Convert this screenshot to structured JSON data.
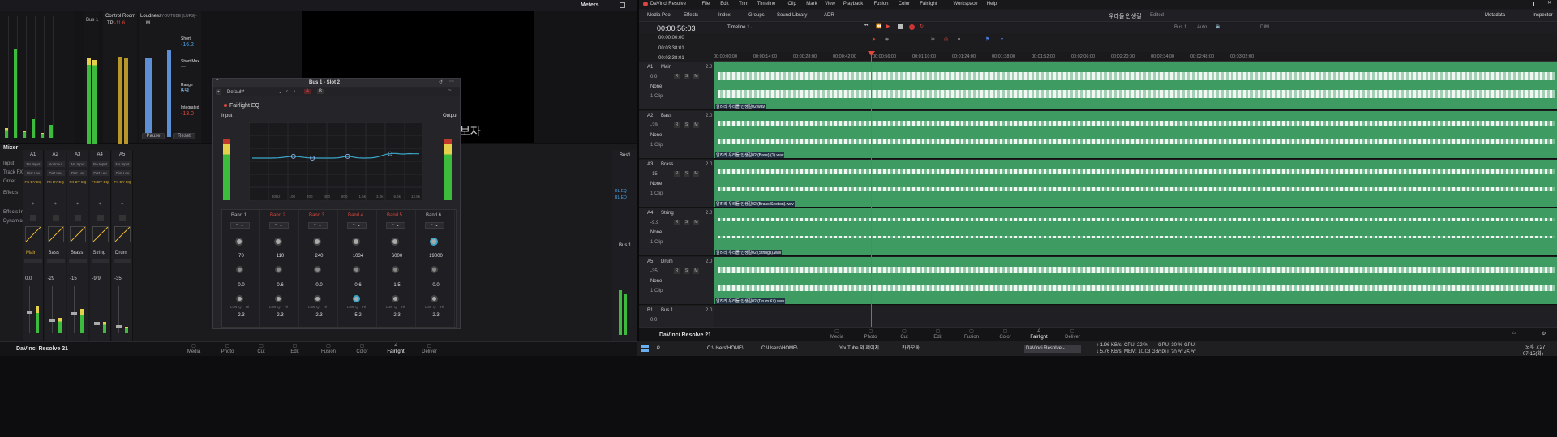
{
  "meters": {
    "title": "Meters",
    "bus_label": "Bus 1",
    "control_room": "Control Room",
    "tp_label": "TP",
    "tp_value": "-11.6",
    "loudness_label": "Loudness",
    "loudness_standard": "YOUTUBE (LUFS)",
    "m_label": "M",
    "short_label": "Short",
    "short_value": "-16.2",
    "short_max_label": "Short Max",
    "short_max_value": "---",
    "range_label": "Range (LU)",
    "range_value": "5.3",
    "integrated_label": "Integrated",
    "integrated_value": "-13.0",
    "pause_label": "Pause",
    "reset_label": "Reset",
    "overlay_text": "보자"
  },
  "mixer": {
    "title": "Mixer",
    "channels": [
      "A1",
      "A2",
      "A3",
      "A4",
      "A5"
    ],
    "row_labels": [
      "Input",
      "Track FX",
      "Order",
      "Effects",
      "Effects In",
      "Dynamics"
    ],
    "input_value": "No Input",
    "track_fx_value": "Dist Lev",
    "order_value": "FX DY EQ",
    "track_names": [
      "Main",
      "Bass",
      "Brass",
      "String",
      "Drum"
    ],
    "fader_values": [
      "0.0",
      "-29",
      "-15",
      "-9.9",
      "-35"
    ],
    "bus_label": "Bus1",
    "bus_name": "Bus 1",
    "bus_eq": [
      "RL EQ",
      "RL EQ"
    ]
  },
  "eq": {
    "title": "Bus 1 - Slot 2",
    "preset": "Default*",
    "ab": [
      "A",
      "B"
    ],
    "plugin_name": "Fairlight EQ",
    "input_label": "Input",
    "output_label": "Output",
    "freq_ticks": [
      "30Hz",
      "100",
      "200",
      "400",
      "800",
      "1.6k",
      "3.2k",
      "6.4k",
      "12.8k"
    ],
    "bands": [
      {
        "name": "Band 1",
        "freq": "70",
        "gain": "0.0",
        "q": "2.3",
        "active": false
      },
      {
        "name": "Band 2",
        "freq": "110",
        "gain": "0.6",
        "q": "2.3",
        "active": true
      },
      {
        "name": "Band 3",
        "freq": "240",
        "gain": "0.0",
        "q": "2.3",
        "active": true
      },
      {
        "name": "Band 4",
        "freq": "1034",
        "gain": "0.6",
        "q": "5.2",
        "active": true
      },
      {
        "name": "Band 5",
        "freq": "6000",
        "gain": "1.5",
        "q": "2.3",
        "active": true
      },
      {
        "name": "Band 6",
        "freq": "19000",
        "gain": "0.0",
        "q": "2.3",
        "active": false
      }
    ],
    "knob_labels": {
      "low": "Low",
      "q": "Q",
      "hi": "Hi"
    }
  },
  "left_pages": {
    "app_name": "DaVinci Resolve 21",
    "items": [
      "Media",
      "Photo",
      "Cut",
      "Edit",
      "Fusion",
      "Color",
      "Fairlight",
      "Deliver"
    ],
    "active": "Fairlight"
  },
  "resolve": {
    "title": "DaVinci Resolve 21",
    "menu": [
      "DaVinci Resolve",
      "File",
      "Edit",
      "Trim",
      "Timeline",
      "Clip",
      "Mark",
      "View",
      "Playback",
      "Fusion",
      "Color",
      "Fairlight",
      "Workspace",
      "Help"
    ],
    "toolbar": [
      "Media Pool",
      "Effects",
      "Index",
      "Groups",
      "Sound Library",
      "ADR"
    ],
    "project_name": "우리들 인생길",
    "edited": "Edited",
    "metadata": "Metadata",
    "inspector": "Inspector",
    "timecode": "00:00:56:03",
    "timeline_name": "Timeline 1",
    "timecodes": [
      "00:00:00:00",
      "00:03:38:01",
      "00:03:38:01"
    ],
    "bus_auto": "Bus 1",
    "auto_label": "Auto",
    "dim": "DIM",
    "ruler": [
      "00:00:00:00",
      "00:00:14:00",
      "00:00:28:00",
      "00:00:42:00",
      "00:00:56:00",
      "00:01:10:00",
      "00:01:24:00",
      "00:01:38:00",
      "00:01:52:00",
      "00:02:06:00",
      "00:02:20:00",
      "00:02:34:00",
      "00:02:48:00",
      "00:03:02:00"
    ],
    "tracks": [
      {
        "id": "A1",
        "name": "Main",
        "level": "0.0",
        "gain": "2.0",
        "bus": "None",
        "clips": "1 Clip",
        "clip_name": "알려라 우리들 인생길02.wav"
      },
      {
        "id": "A2",
        "name": "Bass",
        "level": "-29",
        "gain": "2.0",
        "bus": "None",
        "clips": "1 Clip",
        "clip_name": "알려라 우리들 인생길02 (Bass) (1).wav"
      },
      {
        "id": "A3",
        "name": "Brass",
        "level": "-15",
        "gain": "2.0",
        "bus": "None",
        "clips": "1 Clip",
        "clip_name": "알려라 우리들 인생길02 (Brass Section).wav"
      },
      {
        "id": "A4",
        "name": "String",
        "level": "-9.9",
        "gain": "2.0",
        "bus": "None",
        "clips": "1 Clip",
        "clip_name": "알려라 우리들 인생길02 (Strings).wav"
      },
      {
        "id": "A5",
        "name": "Drum",
        "level": "-35",
        "gain": "2.0",
        "bus": "None",
        "clips": "1 Clip",
        "clip_name": "알려라 우리들 인생길02 (Drum Kit).wav"
      }
    ],
    "bus_track": {
      "id": "B1",
      "name": "Bus 1",
      "level": "0.0",
      "gain": "2.0"
    },
    "pages": [
      "Media",
      "Photo",
      "Cut",
      "Edit",
      "Fusion",
      "Color",
      "Fairlight",
      "Deliver"
    ],
    "active_page": "Fairlight"
  },
  "taskbar": {
    "items": [
      "C:\\Users\\HOME\\...",
      "C:\\Users\\HOME\\...",
      "YouTube 와 제이지...",
      "카카오톡",
      "DaVinci Resolve -..."
    ],
    "net_up": "↑ 1.96 KB/s",
    "net_down": "↓ 5.76 KB/s",
    "cpu": "CPU: 22 %",
    "mem": "MEM: 10.03 GB",
    "gpu": "GPU: 30 %",
    "cpu_temp": "CPU: 70 ℃",
    "gpu_label": "GPU:",
    "gpu_temp": "45 ℃",
    "time": "오후 7:27",
    "date": "07-15(화)"
  }
}
